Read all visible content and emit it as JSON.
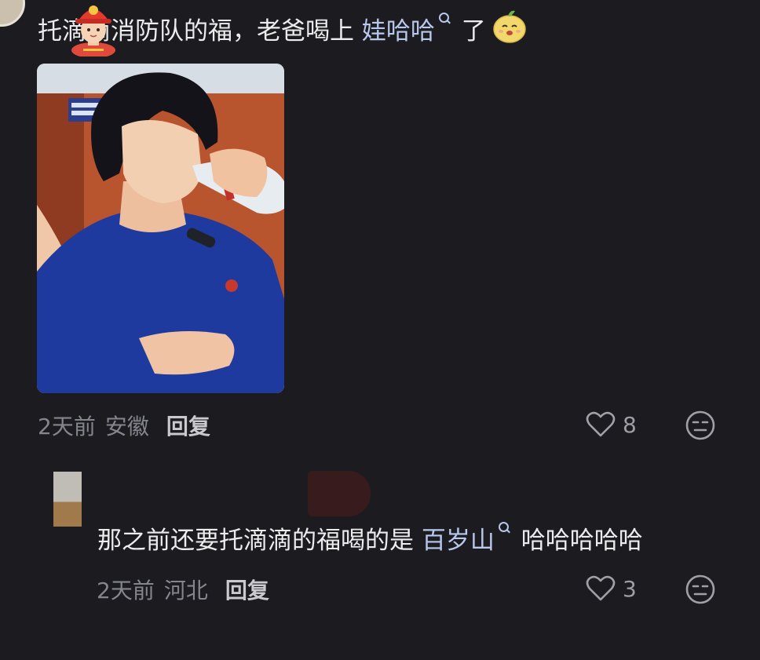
{
  "comment": {
    "text_before": "托滴滴消防队的福，老爸喝上 ",
    "mention": "娃哈哈",
    "text_after": " 了",
    "time": "2天前",
    "location": "安徽",
    "reply_label": "回复",
    "likes": "8"
  },
  "reply": {
    "text_before": "那之前还要托滴滴的福喝的是 ",
    "mention": "百岁山",
    "text_after": " 哈哈哈哈哈",
    "time": "2天前",
    "location": "河北",
    "reply_label": "回复",
    "likes": "3"
  },
  "colors": {
    "background": "#1b1b20",
    "mention": "#b8c8ec",
    "meta_text": "#85868d"
  },
  "icons": [
    "firefighter-emoji",
    "lemon-emoji",
    "search-icon",
    "heart-icon",
    "expressionless-face-icon"
  ]
}
